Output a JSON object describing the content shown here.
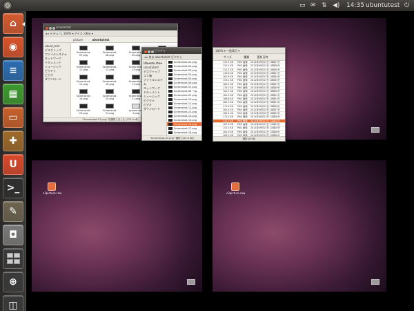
{
  "panel": {
    "time": "14:35",
    "user": "ubuntutest",
    "icons": [
      "keyboard-icon",
      "mail-icon",
      "network-icon",
      "volume-icon",
      "session-icon"
    ]
  },
  "launcher": {
    "items": [
      {
        "name": "home-folder",
        "glyph": "⌂",
        "color": "#d55a2f"
      },
      {
        "name": "firefox",
        "glyph": "◉",
        "color": "#d9532a"
      },
      {
        "name": "writer",
        "glyph": "≡",
        "color": "#2c6db2"
      },
      {
        "name": "calc",
        "glyph": "▦",
        "color": "#3d9a2f"
      },
      {
        "name": "impress",
        "glyph": "▭",
        "color": "#c8602b"
      },
      {
        "name": "software-center",
        "glyph": "✚",
        "color": "#9e6a2b"
      },
      {
        "name": "ubuntu-one",
        "glyph": "U",
        "color": "#d9482a"
      },
      {
        "name": "terminal",
        "glyph": ">_",
        "color": "#2f2f2f"
      },
      {
        "name": "gimp",
        "glyph": "✎",
        "color": "#6d6450"
      },
      {
        "name": "screenshot",
        "glyph": "◘",
        "color": "#7a7a7a"
      },
      {
        "name": "workspace-switcher",
        "glyph": "",
        "color": "#3a3a3a"
      },
      {
        "name": "zoom",
        "glyph": "⊕",
        "color": "#3a3a3a"
      },
      {
        "name": "trash",
        "glyph": "◫",
        "color": "#3a3a3a"
      }
    ]
  },
  "desktop_icon_label": "c3picture.raw",
  "win1": {
    "title": "screenshot",
    "toolbar": "◂ ▸ ✕ ⟳ ⌂ 🔍 100% ▾ アイコン表示 ▾",
    "tabs": [
      "picture",
      "ubuntutest"
    ],
    "sidebar": [
      "ubunt_test",
      "デスクトップ",
      "ファイルシステム",
      "ネットワーク",
      "ドキュメント",
      "ミュージック",
      "ピクチャ",
      "ビデオ",
      "ダウンロード"
    ],
    "files": [
      "Screenshot-07.png",
      "Screenshot-08.png",
      "Screenshot-09.png",
      "Screenshot-10.png",
      "Screenshot-11.png",
      "Screenshot-12.png",
      "Screenshot-13.png",
      "Screenshot-14.png",
      "Screenshot-15.png",
      "Screenshot-16.png",
      "Screenshot-17.png",
      "Screenshot-18.png",
      "Screenshot-19.png",
      "Screenshot-20.png",
      "Screenshot-21.png",
      "Screenshot-22.png",
      "Screenshot-23.png",
      "Screenshot-24.png",
      "gnome-scr-1.png",
      "gnome-scr-2.png"
    ],
    "status": "\"Screenshot-01.png\" を選択しました (122.0 kB)"
  },
  "win2": {
    "title": "ピクチャ",
    "toolbar": "◂ ▸ 戻る  ubuntutest  ピクチャ",
    "sidebar_header": "Ubuntu One",
    "sidebar": [
      "ubuntutest",
      "デスクトップ",
      "ゴミ箱",
      "ファイルシステム",
      "ネットワーク",
      "ドキュメント",
      "ミュージック",
      "ピクチャ",
      "ビデオ",
      "ダウンロード"
    ],
    "files": [
      "Screenshot-01.png",
      "Screenshot-02.png",
      "Screenshot-03.png",
      "Screenshot-04.png",
      "Screenshot-05.png",
      "Screenshot-06.png",
      "Screenshot-07.png",
      "Screenshot-08.png",
      "Screenshot-09.png",
      "Screenshot-10.png",
      "Screenshot-11.png",
      "Screenshot-12.png",
      "Screenshot-13.png",
      "Screenshot-14.png",
      "Screenshot-15.png",
      "Screenshot-16.png",
      "Screenshot-17.png",
      "Screenshot-18.png"
    ],
    "selected_index": 15,
    "status": "\"Screenshot-01.png\" 選択 (122.0 kB)"
  },
  "win3": {
    "toolbar": "100% ▾  一覧表示 ▾",
    "headers": [
      "サイズ",
      "種類",
      "更新日時"
    ],
    "rows": [
      [
        "151.5 KB",
        "PNG 画像",
        "2011年09月13日 10時37分"
      ],
      [
        "151.5 KB",
        "PNG 画像",
        "2011年09月13日 10時38分"
      ],
      [
        "151.5 KB",
        "PNG 画像",
        "2011年09月13日 10時40分"
      ],
      [
        "144.8 KB",
        "PNG 画像",
        "2011年09月13日 10時41分"
      ],
      [
        "161.8 KB",
        "PNG 画像",
        "2011年09月13日 10時44分"
      ],
      [
        "153.1 KB",
        "PNG 画像",
        "2011年09月13日 10時45分"
      ],
      [
        "160.2 KB",
        "PNG 画像",
        "2011年09月13日 10時47分"
      ],
      [
        "179.2 KB",
        "PNG 画像",
        "2011年09月13日 10時49分"
      ],
      [
        "181.5 KB",
        "PNG 画像",
        "2011年09月13日 10時50分"
      ],
      [
        "181.5 KB",
        "PNG 画像",
        "2011年09月13日 10時51分"
      ],
      [
        "169.8 KB",
        "PNG 画像",
        "2011年09月13日 10時53分"
      ],
      [
        "162.5 KB",
        "PNG 画像",
        "2011年09月13日 10時54分"
      ],
      [
        "172.6 KB",
        "PNG 画像",
        "2011年09月13日 10時56分"
      ],
      [
        "161.4 KB",
        "PNG 画像",
        "2011年09月13日 10時57分"
      ],
      [
        "180.2 KB",
        "PNG 画像",
        "2011年09月13日 10時59分"
      ],
      [
        "171.5 KB",
        "PNG 画像",
        "2011年09月13日 11時00分"
      ],
      [
        "141.2 KB",
        "PNG 画像",
        "2011年09月13日 11時02分"
      ],
      [
        "167.0 KB",
        "PNG 画像",
        "2011年09月13日 11時03分"
      ],
      [
        "151.5 KB",
        "PNG 画像",
        "2011年09月13日 11時05分"
      ],
      [
        "182.0 KB",
        "PNG 画像",
        "2011年09月13日 11時06分"
      ],
      [
        "163.5 KB",
        "PNG 画像",
        "2011年09月13日 11時08分"
      ]
    ],
    "selected_index": 16,
    "status": "選択 (6 KB)"
  }
}
